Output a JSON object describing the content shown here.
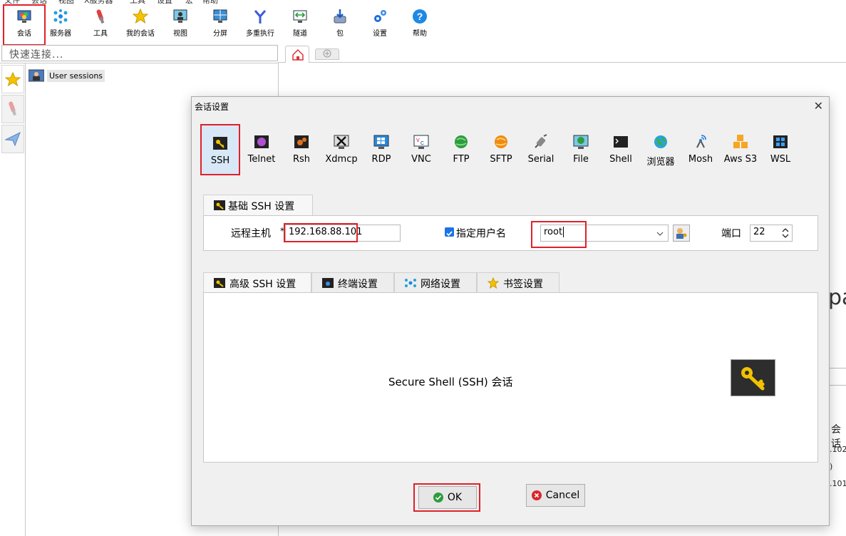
{
  "menubar": {
    "items": [
      "文件",
      "会话",
      "视图",
      "X服务器",
      "工具",
      "设置",
      "宏",
      "帮助"
    ]
  },
  "toolbar": {
    "items": [
      {
        "label": "会话",
        "icon": "session-icon",
        "active": true
      },
      {
        "label": "服务器",
        "icon": "servers-icon"
      },
      {
        "label": "工具",
        "icon": "tools-icon"
      },
      {
        "label": "我的会话",
        "icon": "star-icon"
      },
      {
        "label": "视图",
        "icon": "view-icon"
      },
      {
        "label": "分屏",
        "icon": "split-icon"
      },
      {
        "label": "多重执行",
        "icon": "multiexec-icon"
      },
      {
        "label": "隧道",
        "icon": "tunnel-icon"
      },
      {
        "label": "包",
        "icon": "package-icon"
      },
      {
        "label": "设置",
        "icon": "settings-icon"
      },
      {
        "label": "帮助",
        "icon": "help-icon"
      }
    ]
  },
  "quick_connect": {
    "placeholder": "快速连接..."
  },
  "left_pane": {
    "user_sessions": "User sessions"
  },
  "background": {
    "frag1": "pa",
    "frag2": "会话",
    "frag3": ".102",
    "frag4": ")",
    "frag5": ".101"
  },
  "dialog": {
    "title": "会话设置",
    "close": "✕",
    "protocols": [
      "SSH",
      "Telnet",
      "Rsh",
      "Xdmcp",
      "RDP",
      "VNC",
      "FTP",
      "SFTP",
      "Serial",
      "File",
      "Shell",
      "浏览器",
      "Mosh",
      "Aws S3",
      "WSL"
    ],
    "selected_protocol": "SSH",
    "base_tab": "基础 SSH 设置",
    "remote_host_label": "远程主机",
    "required_mark": "*",
    "remote_host_value": "192.168.88.101",
    "specify_user_label": "指定用户名",
    "specify_user_checked": true,
    "username_value": "root",
    "port_label": "端口",
    "port_value": "22",
    "tabs": [
      "高级 SSH 设置",
      "终端设置",
      "网络设置",
      "书签设置"
    ],
    "description": "Secure Shell (SSH) 会话",
    "ok_label": "OK",
    "cancel_label": "Cancel"
  },
  "colors": {
    "highlight": "#e0202a",
    "selected_bg": "#d8e8f7",
    "ok_green": "#2e9c3e",
    "cancel_red": "#d9262c"
  }
}
